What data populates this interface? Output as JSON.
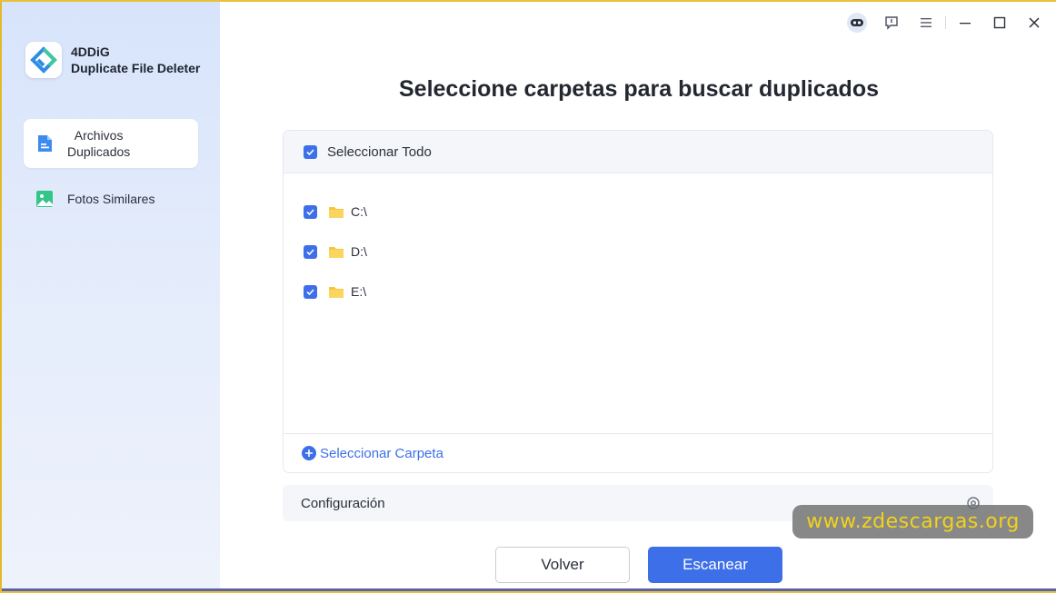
{
  "app": {
    "brand_name": "4DDiG",
    "product_name": "Duplicate File Deleter"
  },
  "titlebar": {
    "icons": [
      "assistant-icon",
      "feedback-icon",
      "menu-icon",
      "minimize-icon",
      "maximize-icon",
      "close-icon"
    ]
  },
  "sidebar": {
    "items": [
      {
        "label_line1": "Archivos",
        "label_line2": "Duplicados",
        "icon": "document-icon",
        "active": true
      },
      {
        "label": "Fotos Similares",
        "icon": "image-icon",
        "active": false
      }
    ]
  },
  "main": {
    "title": "Seleccione carpetas para buscar duplicados",
    "select_all": {
      "label": "Seleccionar Todo",
      "checked": true
    },
    "drives": [
      {
        "label": "C:\\",
        "checked": true
      },
      {
        "label": "D:\\",
        "checked": true
      },
      {
        "label": "E:\\",
        "checked": true
      }
    ],
    "add_folder_label": "Seleccionar Carpeta",
    "settings_label": "Configuración",
    "back_label": "Volver",
    "scan_label": "Escanear"
  },
  "colors": {
    "accent": "#3d6fe8",
    "folder": "#f5c542",
    "sidebar_bg": "#dde7fb"
  },
  "watermark": "www.zdescargas.org"
}
